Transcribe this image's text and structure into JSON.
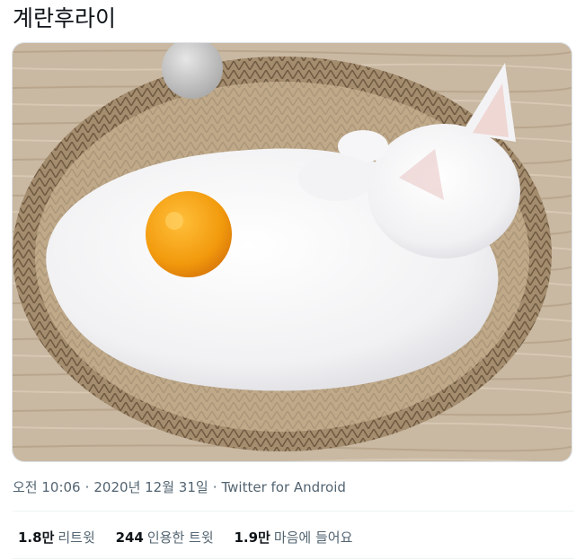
{
  "tweet": {
    "text": "계란후라이",
    "media_alt": "",
    "time": "오전 10:06",
    "date": "2020년 12월 31일",
    "separator": "·",
    "source": "Twitter for Android"
  },
  "stats": [
    {
      "count": "1.8만",
      "label": "리트윗"
    },
    {
      "count": "244",
      "label": "인용한 트윗"
    },
    {
      "count": "1.9만",
      "label": "마음에 들어요"
    }
  ],
  "colors": {
    "text": "#0f1419",
    "secondary": "#536471",
    "border": "#eff3f4"
  }
}
